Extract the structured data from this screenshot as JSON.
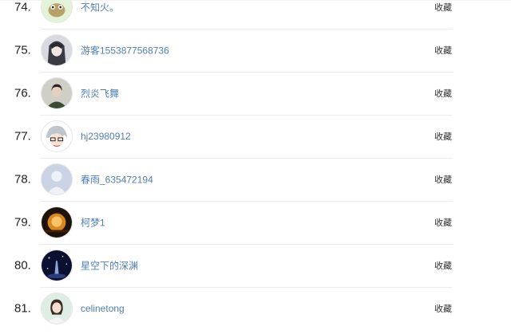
{
  "rows": [
    {
      "rank": "74.",
      "name": "不知火。",
      "action": "收藏",
      "avatar_icon": "cartoon-frog-avatar-icon"
    },
    {
      "rank": "75.",
      "name": "游客1553877568736",
      "action": "收藏",
      "avatar_icon": "anime-character-avatar-icon"
    },
    {
      "rank": "76.",
      "name": "烈炎飞舞",
      "action": "收藏",
      "avatar_icon": "person-photo-avatar-icon"
    },
    {
      "rank": "77.",
      "name": "hj23980912",
      "action": "收藏",
      "avatar_icon": "anime-silver-hair-avatar-icon"
    },
    {
      "rank": "78.",
      "name": "春雨_635472194",
      "action": "收藏",
      "avatar_icon": "default-user-avatar-icon"
    },
    {
      "rank": "79.",
      "name": "柯梦1",
      "action": "收藏",
      "avatar_icon": "lamp-photo-avatar-icon"
    },
    {
      "rank": "80.",
      "name": "星空下的深渊",
      "action": "收藏",
      "avatar_icon": "night-sky-avatar-icon"
    },
    {
      "rank": "81.",
      "name": "celinetong",
      "action": "收藏",
      "avatar_icon": "girl-photo-avatar-icon"
    }
  ]
}
